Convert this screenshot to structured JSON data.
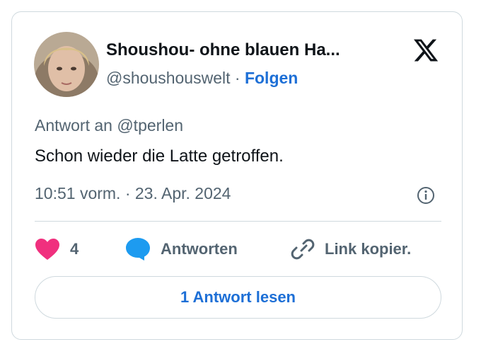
{
  "tweet": {
    "author_name": "Shoushou- ohne blauen Ha...",
    "handle": "@shoushouswelt",
    "separator": "·",
    "follow_label": "Folgen",
    "reply_to": "Antwort an @tperlen",
    "text": "Schon wieder die Latte getroffen.",
    "timestamp": "10:51 vorm. · 23. Apr. 2024"
  },
  "icons": {
    "brand": "x-logo-icon",
    "info": "info-icon",
    "like": "heart-icon",
    "reply": "speech-bubble-icon",
    "copy": "link-icon"
  },
  "actions": {
    "like_count": "4",
    "reply_label": "Antworten",
    "copy_label": "Link kopier."
  },
  "read_button": {
    "label": "1 Antwort lesen"
  },
  "colors": {
    "accent": "#1d6fd6",
    "heart": "#f0307e",
    "reply_bubble": "#1d9bf0",
    "text": "#0f1419",
    "muted": "#536471",
    "border": "#cfd9de"
  }
}
